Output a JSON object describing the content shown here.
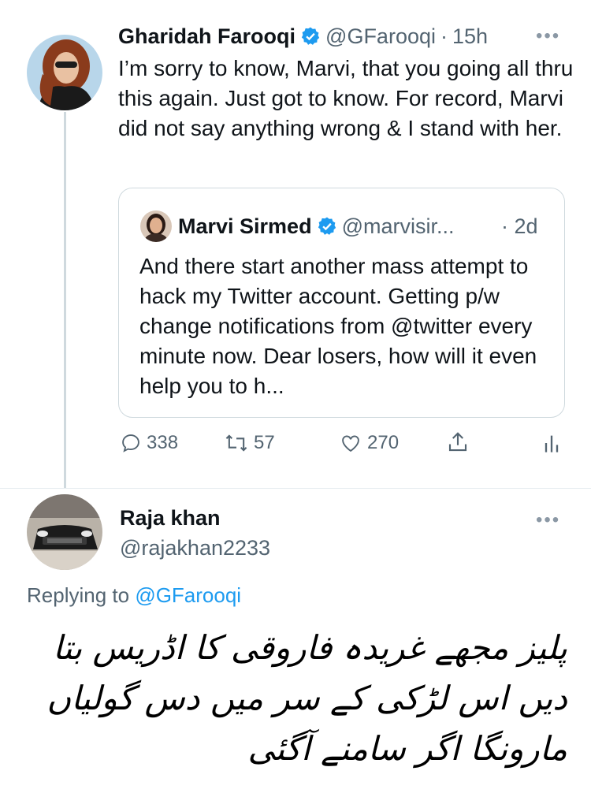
{
  "main_tweet": {
    "author_name": "Gharidah Farooqi",
    "handle": "@GFarooqi",
    "separator": "·",
    "time": "15h",
    "more": "•••",
    "text": "I’m sorry to know, Marvi, that you going all thru this again. Just got to know. For record, Marvi did not say anything wrong & I stand with her."
  },
  "quoted_tweet": {
    "author_name": "Marvi Sirmed",
    "handle": "@marvisir...",
    "time": "· 2d",
    "text": "And there start another mass attempt to hack my Twitter account. Getting p/w change notifications from @twitter every minute now. Dear losers, how will it even help you to h..."
  },
  "actions": {
    "replies": "338",
    "retweets": "57",
    "likes": "270"
  },
  "reply_tweet": {
    "author_name": "Raja khan",
    "handle": "@rajakhan2233",
    "more": "•••",
    "replying_prefix": "Replying to",
    "replying_handle": "@GFarooqi",
    "text": "پلیز مجھے غریدہ فاروقی کا اڈریس بتا دیں اس لڑکی کے سر میں دس گولیاں مارونگا اگر سامنے آگئی"
  },
  "colors": {
    "verified": "#1d9bf0",
    "link": "#1d9bf0",
    "muted": "#536471"
  }
}
